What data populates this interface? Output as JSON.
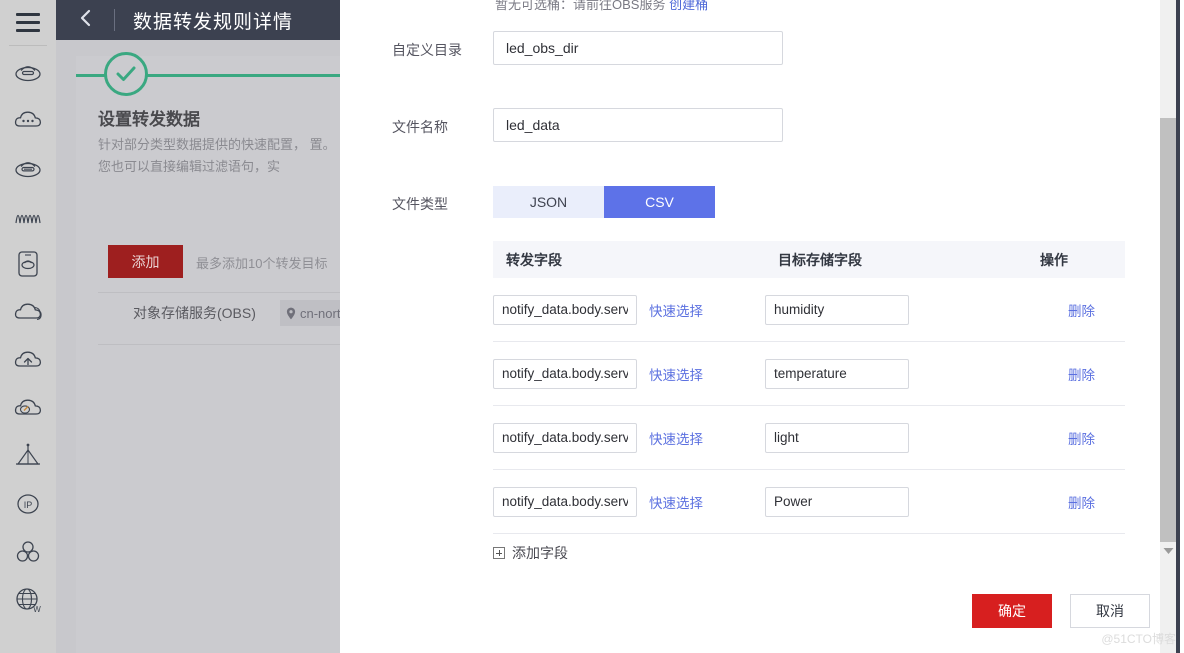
{
  "rail": {
    "menu_icon": "hamburger-menu-icon",
    "icons": [
      {
        "name": "cloud-server-icon"
      },
      {
        "name": "cloud-dots-icon"
      },
      {
        "name": "cloud-storage-icon"
      },
      {
        "name": "waveform-icon"
      },
      {
        "name": "cloud-device-icon"
      },
      {
        "name": "cloud-stack-icon"
      },
      {
        "name": "cloud-upload-icon"
      },
      {
        "name": "cloud-check-icon"
      },
      {
        "name": "pyramid-antenna-icon"
      },
      {
        "name": "ip-address-icon"
      },
      {
        "name": "cluster-nodes-icon"
      },
      {
        "name": "globe-web-icon"
      }
    ]
  },
  "topbar": {
    "back_icon": "chevron-left-icon",
    "title": "数据转发规则详情"
  },
  "wizard": {
    "check_icon": "check-circle-icon",
    "step_title": "设置转发数据",
    "step_desc": "针对部分类型数据提供的快速配置，\n置。您也可以直接编辑过滤语句，实",
    "add_button": "添加",
    "add_hint": "最多添加10个转发目标",
    "target_label": "对象存储服务(OBS)",
    "region_icon": "location-pin-icon",
    "region_value": "cn-nort"
  },
  "modal": {
    "notice_text": "暂无可选桶：请前往OBS服务",
    "notice_link": "创建桶",
    "fields": [
      {
        "label": "自定义目录",
        "value": "led_obs_dir",
        "name": "custom-directory"
      },
      {
        "label": "文件名称",
        "value": "led_data",
        "name": "file-name"
      }
    ],
    "file_type": {
      "label": "文件类型",
      "options": [
        "JSON",
        "CSV"
      ],
      "selected": "CSV"
    },
    "table": {
      "headers": [
        "转发字段",
        "目标存储字段",
        "操作"
      ],
      "quick_select_label": "快速选择",
      "delete_label": "删除",
      "rows": [
        {
          "source": "notify_data.body.services",
          "target": "humidity"
        },
        {
          "source": "notify_data.body.services",
          "target": "temperature"
        },
        {
          "source": "notify_data.body.services",
          "target": "light"
        },
        {
          "source": "notify_data.body.services",
          "target": "Power"
        }
      ]
    },
    "add_field_label": "添加字段",
    "add_field_icon": "plus-square-icon",
    "confirm_label": "确定",
    "cancel_label": "取消"
  },
  "scrollbar": {
    "down_arrow_icon": "chevron-down-icon"
  },
  "watermark": "@51CTO博客",
  "colors": {
    "accent_red": "#d71f1f",
    "accent_blue": "#5d72e8",
    "link_blue": "#5b70e0",
    "step_green": "#3aa881",
    "topbar_dark": "#3c4150"
  }
}
